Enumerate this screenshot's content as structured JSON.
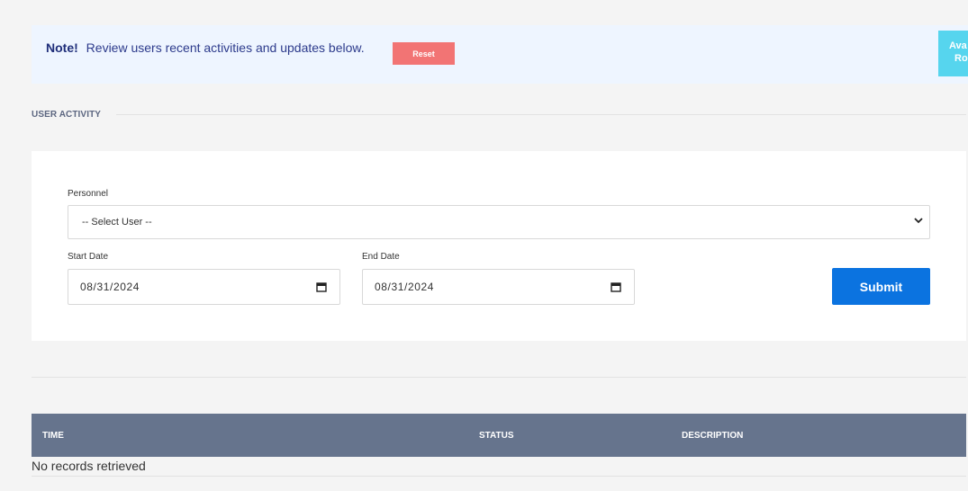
{
  "alert": {
    "note_label": "Note!",
    "message": "Review users recent activities and updates below.",
    "reset_label": "Reset",
    "side_button_line1": "Ava",
    "side_button_line2": "Ro"
  },
  "section": {
    "title": "USER ACTIVITY"
  },
  "form": {
    "personnel_label": "Personnel",
    "personnel_value": "-- Select User --",
    "start_date_label": "Start Date",
    "start_date_value": "08/31/2024",
    "end_date_label": "End Date",
    "end_date_value": "08/31/2024",
    "submit_label": "Submit"
  },
  "table": {
    "columns": [
      "TIME",
      "STATUS",
      "DESCRIPTION"
    ],
    "empty_message": "No records retrieved"
  },
  "colors": {
    "alert_bg": "#eef5ff",
    "reset": "#f27474",
    "side_button": "#56d5ee",
    "submit": "#0b73e0",
    "table_header": "#66748d"
  },
  "icons": {
    "select": "chevron-down-icon",
    "date": "calendar-icon"
  }
}
